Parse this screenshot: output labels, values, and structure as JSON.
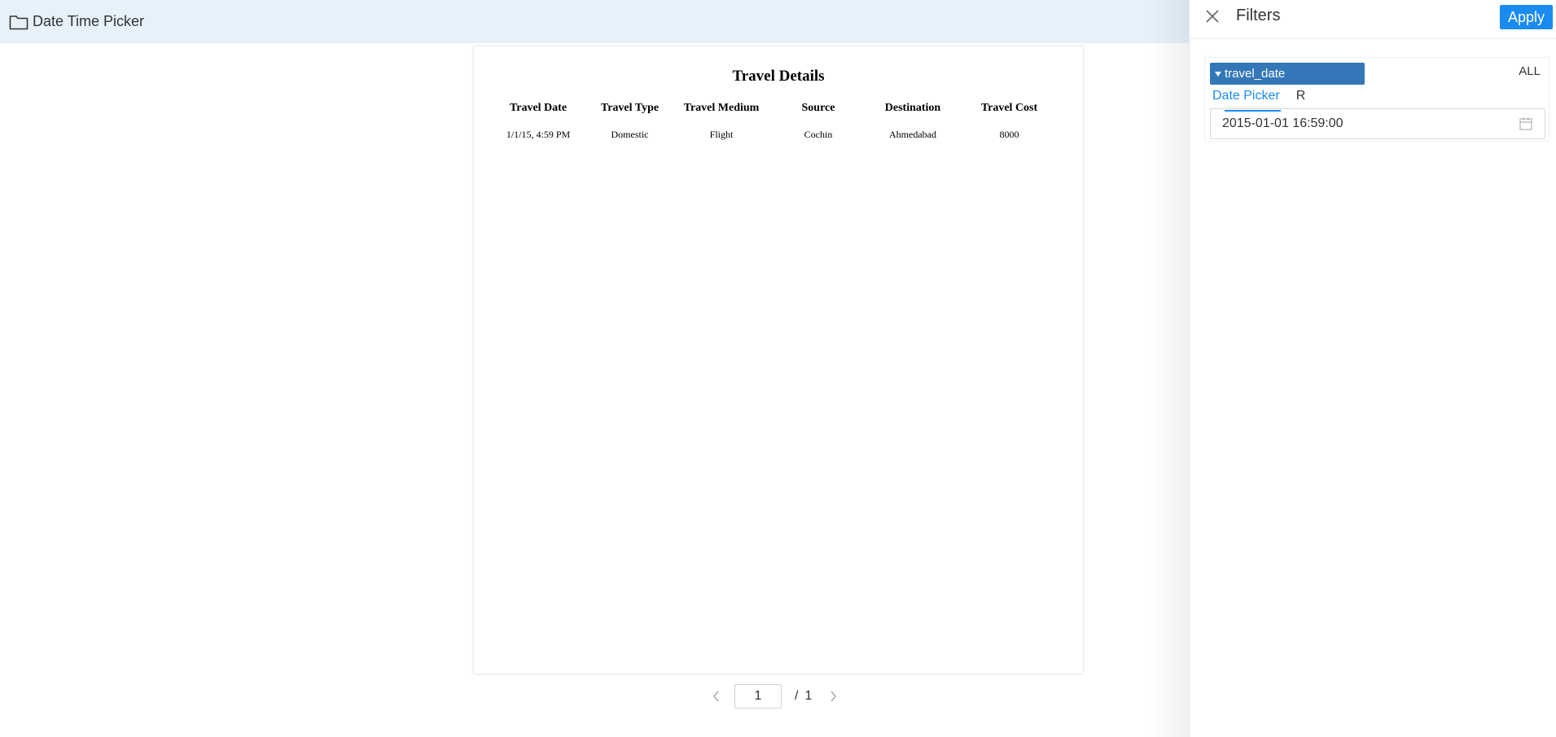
{
  "header": {
    "title": "Date Time Picker"
  },
  "report": {
    "title": "Travel Details",
    "columns": [
      "Travel Date",
      "Travel Type",
      "Travel Medium",
      "Source",
      "Destination",
      "Travel Cost"
    ],
    "rows": [
      [
        "1/1/15, 4:59 PM",
        "Domestic",
        "Flight",
        "Cochin",
        "Ahmedabad",
        "8000"
      ]
    ]
  },
  "pager": {
    "current_page": "1",
    "separator": "/",
    "total_pages": "1"
  },
  "filters": {
    "title": "Filters",
    "apply_label": "Apply",
    "field_name": "travel_date",
    "all_label": "ALL",
    "tabs": [
      {
        "label": "Date Picker",
        "active": true
      },
      {
        "label": "R",
        "active": false
      }
    ],
    "date_value": "2015-01-01 16:59:00"
  },
  "colors": {
    "header_bg": "#e6f1fa",
    "accent": "#1a8cef",
    "chip": "#3377b8"
  },
  "icons": [
    "folder-icon",
    "close-icon",
    "caret-down-icon",
    "calendar-icon",
    "chevron-left-icon",
    "chevron-right-icon"
  ]
}
